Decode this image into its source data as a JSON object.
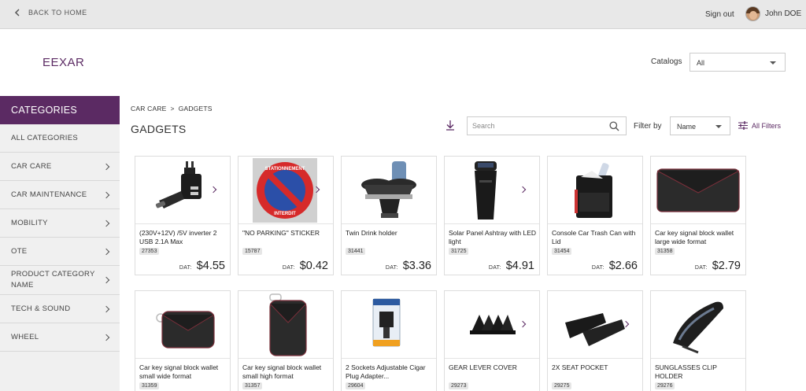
{
  "topbar": {
    "back_label": "BACK TO HOME",
    "signout_label": "Sign out",
    "user_name": "John DOE"
  },
  "header": {
    "logo": "EEXAR",
    "catalogs_label": "Catalogs",
    "catalogs_value": "All"
  },
  "sidebar": {
    "title": "CATEGORIES",
    "items": [
      {
        "label": "ALL CATEGORIES",
        "chevron": false
      },
      {
        "label": "CAR CARE",
        "chevron": true
      },
      {
        "label": "CAR MAINTENANCE",
        "chevron": true
      },
      {
        "label": "MOBILITY",
        "chevron": true
      },
      {
        "label": "OTE",
        "chevron": true
      },
      {
        "label": "PRODUCT CATEGORY NAME",
        "chevron": true
      },
      {
        "label": "TECH & SOUND",
        "chevron": true
      },
      {
        "label": "WHEEL",
        "chevron": true
      }
    ]
  },
  "breadcrumb": {
    "parent": "CAR CARE",
    "separator": ">",
    "current": "GADGETS"
  },
  "page_title": "GADGETS",
  "toolbar": {
    "search_placeholder": "Search",
    "filter_label": "Filter by",
    "filter_value": "Name",
    "all_filters_label": "All Filters"
  },
  "colors": {
    "brand": "#5b2a63",
    "topbar": "#e8e8e8",
    "sidebar": "#f0f0f0"
  },
  "products": [
    {
      "name": "(230V+12V) /5V inverter 2 USB 2.1A Max",
      "code": "27353",
      "dat": "DAT:",
      "price": "$4.55",
      "image": "usb-inverter-image",
      "arrow": true
    },
    {
      "name": "\"NO PARKING\" STICKER",
      "code": "15787",
      "dat": "DAT:",
      "price": "$0.42",
      "image": "no-parking-sticker-image",
      "arrow": true,
      "sticker_top": "STATIONNEMENT",
      "sticker_bottom": "INTERDIT"
    },
    {
      "name": "Twin Drink holder",
      "code": "31441",
      "dat": "DAT:",
      "price": "$3.36",
      "image": "drink-holder-image",
      "arrow": false
    },
    {
      "name": "Solar Panel Ashtray with LED light",
      "code": "31725",
      "dat": "DAT:",
      "price": "$4.91",
      "image": "ashtray-image",
      "arrow": true
    },
    {
      "name": "Console Car Trash Can with Lid",
      "code": "31454",
      "dat": "DAT:",
      "price": "$2.66",
      "image": "trash-can-image",
      "arrow": false
    },
    {
      "name": "Car key signal block wallet large wide format",
      "code": "31358",
      "dat": "DAT:",
      "price": "$2.79",
      "image": "key-wallet-large-image",
      "arrow": false
    },
    {
      "name": "Car key signal block wallet small wide format",
      "code": "31359",
      "image": "key-wallet-small-wide-image",
      "arrow": false
    },
    {
      "name": "Car key signal block wallet small high format",
      "code": "31357",
      "image": "key-wallet-small-high-image",
      "arrow": false
    },
    {
      "name": "2 Sockets Adjustable Cigar Plug Adapter...",
      "code": "29604",
      "image": "cigar-plug-adapter-image",
      "arrow": false
    },
    {
      "name": "GEAR LEVER COVER",
      "code": "29273",
      "image": "gear-lever-cover-image",
      "arrow": true
    },
    {
      "name": "2X SEAT POCKET",
      "code": "29275",
      "image": "seat-pocket-image",
      "arrow": true
    },
    {
      "name": "SUNGLASSES CLIP HOLDER",
      "code": "29276",
      "image": "sunglasses-clip-image",
      "arrow": false
    }
  ]
}
